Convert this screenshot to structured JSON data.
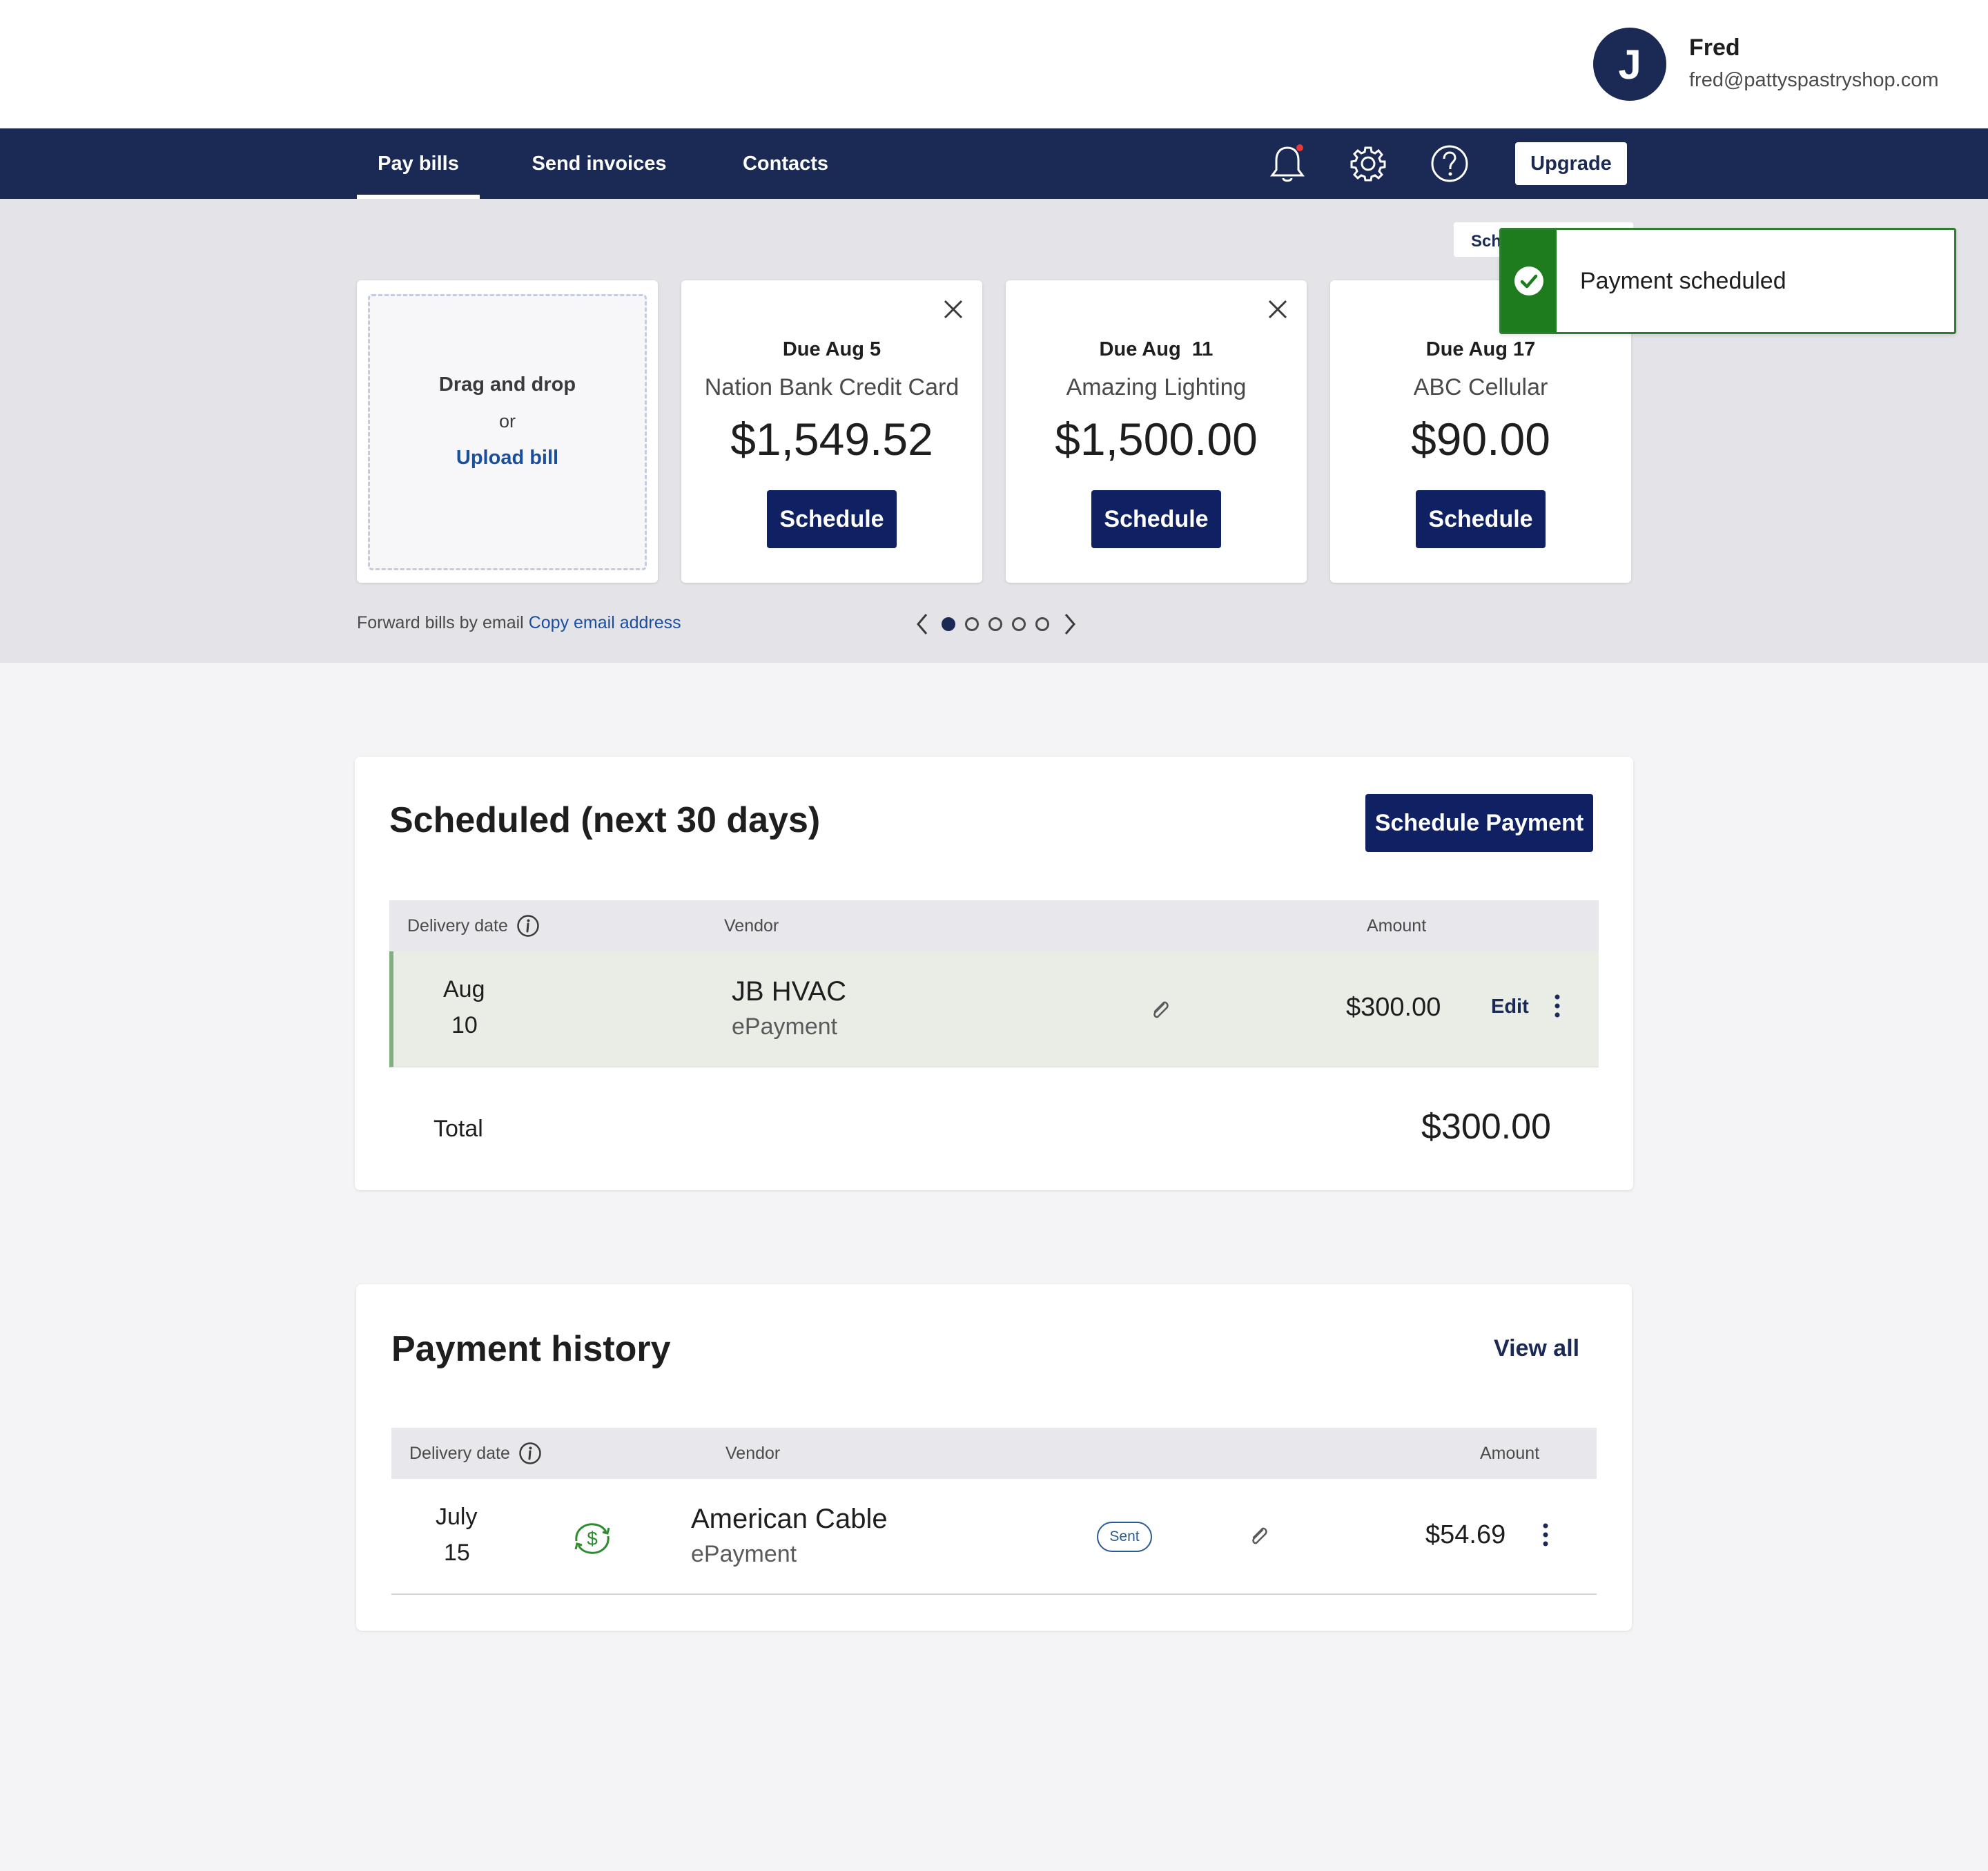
{
  "user": {
    "initial": "J",
    "name": "Fred",
    "email": "fred@pattyspastryshop.com"
  },
  "nav": {
    "tabs": [
      {
        "label": "Pay bills"
      },
      {
        "label": "Send invoices"
      },
      {
        "label": "Contacts"
      }
    ],
    "upgrade_label": "Upgrade"
  },
  "upload": {
    "drag_text": "Drag and drop",
    "or_text": "or",
    "upload_link": "Upload bill"
  },
  "bills": [
    {
      "due": "Due Aug 5",
      "vendor": "Nation Bank Credit Card",
      "amount": "$1,549.52",
      "button": "Schedule"
    },
    {
      "due": "Due Aug  11",
      "vendor": "Amazing Lighting",
      "amount": "$1,500.00",
      "button": "Schedule"
    },
    {
      "due": "Due Aug 17",
      "vendor": "ABC Cellular",
      "amount": "$90.00",
      "button": "Schedule"
    }
  ],
  "forward": {
    "text": "Forward bills by email",
    "link": "Copy email address"
  },
  "carousel": {
    "pages": 5,
    "current": 1
  },
  "toast": {
    "behind_text": "Sch",
    "message": "Payment scheduled"
  },
  "scheduled": {
    "title": "Scheduled (next 30 days)",
    "button": "Schedule Payment",
    "headers": {
      "date": "Delivery date",
      "vendor": "Vendor",
      "amount": "Amount"
    },
    "row": {
      "month": "Aug",
      "day": "10",
      "vendor": "JB HVAC",
      "method": "ePayment",
      "amount": "$300.00",
      "edit": "Edit"
    },
    "total_label": "Total",
    "total_amount": "$300.00"
  },
  "history": {
    "title": "Payment history",
    "view_all": "View all",
    "headers": {
      "date": "Delivery date",
      "vendor": "Vendor",
      "amount": "Amount"
    },
    "row": {
      "month": "July",
      "day": "15",
      "vendor": "American Cable",
      "method": "ePayment",
      "status": "Sent",
      "amount": "$54.69"
    }
  },
  "colors": {
    "navy": "#1b2a55",
    "button_navy": "#0f2163",
    "success_green": "#1e7b1e",
    "link_blue": "#1a4fa0"
  }
}
